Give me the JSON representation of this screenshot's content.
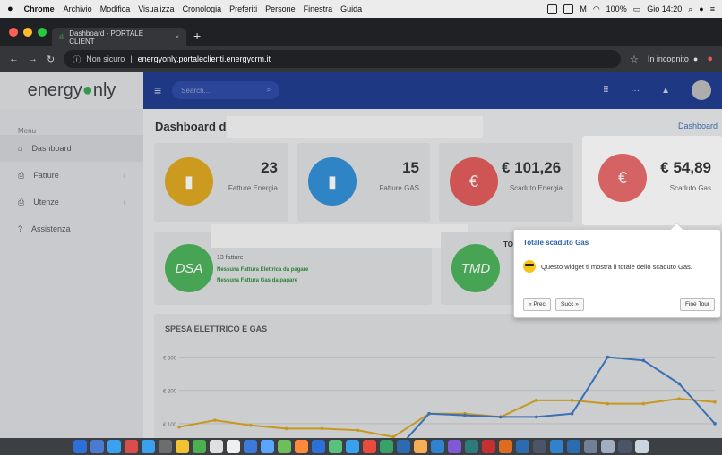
{
  "menubar": {
    "app": "Chrome",
    "items": [
      "Archivio",
      "Modifica",
      "Visualizza",
      "Cronologia",
      "Preferiti",
      "Persone",
      "Finestra",
      "Guida"
    ],
    "battery": "100%",
    "clock": "Gio 14:20"
  },
  "browser": {
    "tab_title": "Dashboard - PORTALE CLIENT",
    "tab_close": "×",
    "new_tab": "+",
    "security": "Non sicuro",
    "url": "energyonly.portaleclienti.energycrm.it",
    "incognito": "In incognito"
  },
  "header": {
    "logo": "energy",
    "logo_tail": "nly",
    "search_placeholder": "Search..."
  },
  "sidebar": {
    "heading": "Menu",
    "items": [
      {
        "label": "Dashboard"
      },
      {
        "label": "Fatture"
      },
      {
        "label": "Utenze"
      },
      {
        "label": "Assistenza"
      }
    ]
  },
  "main": {
    "title": "Dashboard di",
    "breadcrumb": "Dashboard",
    "cards": [
      {
        "value": "23",
        "label": "Fatture Energia",
        "color": "#e0a820"
      },
      {
        "value": "15",
        "label": "Fatture GAS",
        "color": "#2f8fd6"
      },
      {
        "value": "€ 101,26",
        "label": "Scaduto Energia",
        "color": "#e35b5b"
      },
      {
        "value": "€ 54,89",
        "label": "Scaduto Gas",
        "color": "#e35b5b"
      }
    ],
    "dsa": {
      "badge": "DSA",
      "count": "13 fatture",
      "link1": "Nessuna Fattura Elettrica da pagare",
      "link2": "Nessuna Fattura Gas da pagare"
    },
    "tmd": {
      "badge": "TMD",
      "label": "TO"
    },
    "chart_title": "SPESA ELETTRICO E GAS"
  },
  "tour": {
    "title": "Totale scaduto Gas",
    "body": "Questo widget ti mostra il totale dello scaduto Gas.",
    "prev": "« Prec",
    "next": "Succ »",
    "end": "Fine Tour"
  },
  "chart_data": {
    "type": "line",
    "title": "SPESA ELETTRICO E GAS",
    "y_ticks": [
      "€ 300",
      "€ 200",
      "€ 100"
    ],
    "ylim": [
      0,
      350
    ],
    "series": [
      {
        "color": "#d9a520",
        "values": [
          90,
          110,
          95,
          85,
          85,
          80,
          60,
          130,
          130,
          120,
          170,
          170,
          160,
          160,
          175,
          165
        ]
      },
      {
        "color": "#3a78c6",
        "values": [
          40,
          30,
          20,
          15,
          10,
          10,
          10,
          130,
          125,
          120,
          120,
          130,
          300,
          290,
          220,
          100
        ]
      }
    ]
  }
}
